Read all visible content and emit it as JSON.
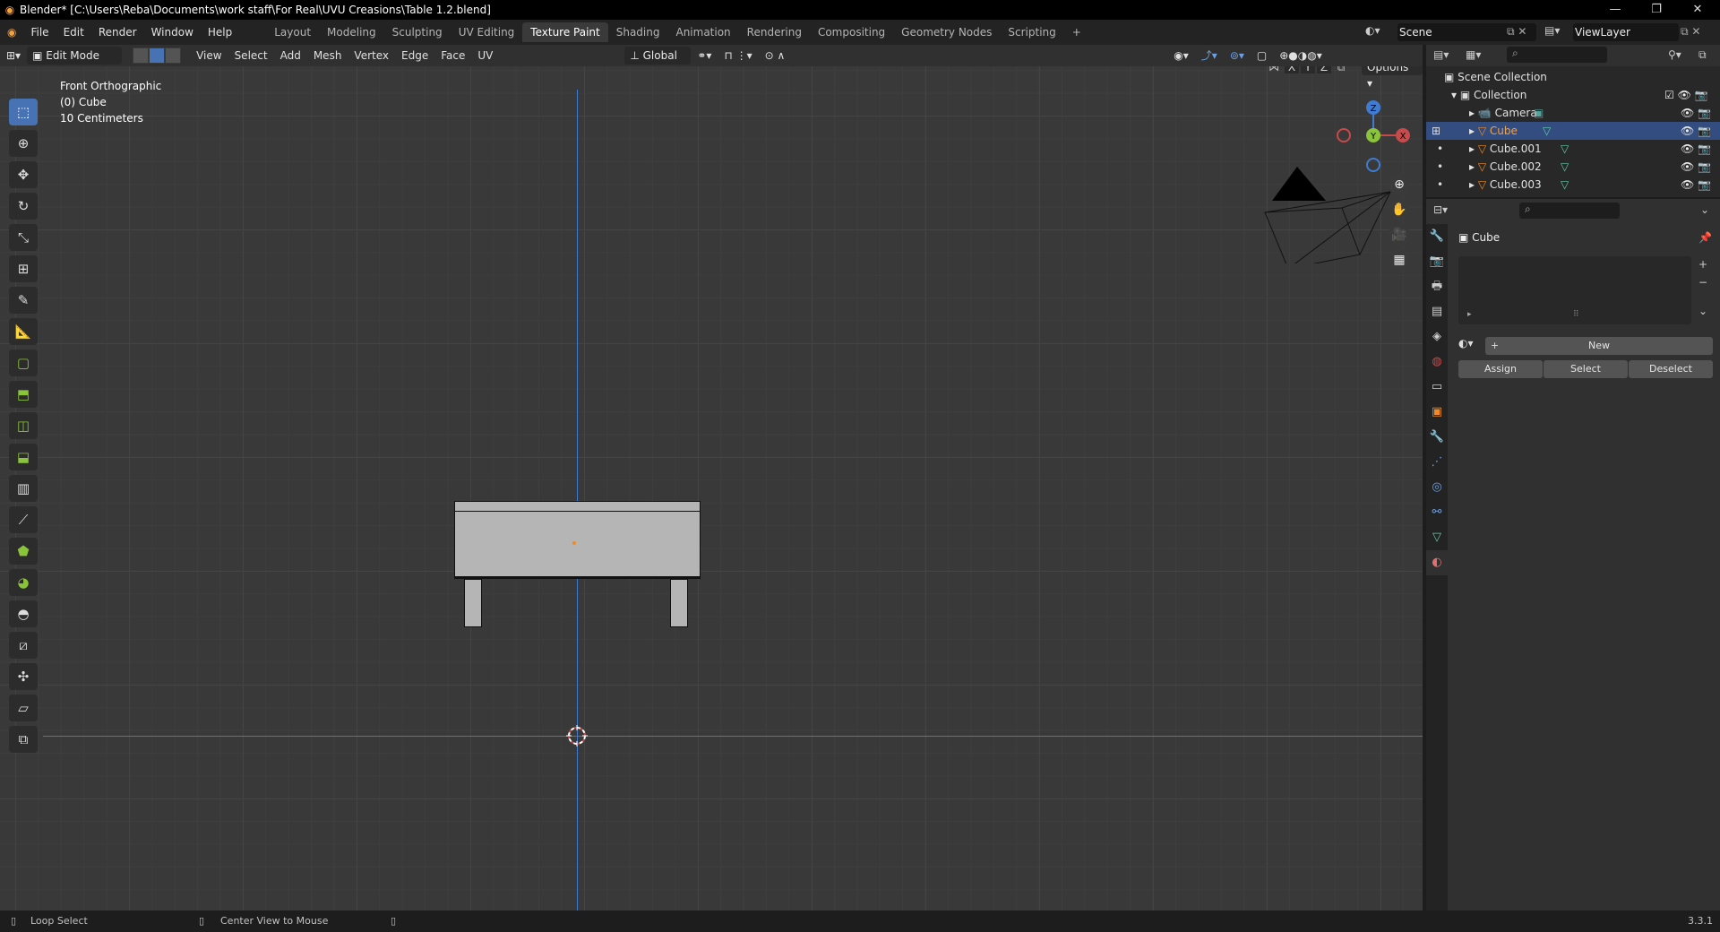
{
  "app": {
    "title": "Blender* [C:\\Users\\Reba\\Documents\\work staff\\For Real\\UVU Creasions\\Table 1.2.blend]"
  },
  "menu": [
    "File",
    "Edit",
    "Render",
    "Window",
    "Help"
  ],
  "workspaces": {
    "tabs": [
      "Layout",
      "Modeling",
      "Sculpting",
      "UV Editing",
      "Texture Paint",
      "Shading",
      "Animation",
      "Rendering",
      "Compositing",
      "Geometry Nodes",
      "Scripting"
    ],
    "active": "Texture Paint",
    "add": "+"
  },
  "scene": {
    "name": "Scene",
    "view_layer": "ViewLayer"
  },
  "header": {
    "mode": "Edit Mode",
    "menus": [
      "View",
      "Select",
      "Add",
      "Mesh",
      "Vertex",
      "Edge",
      "Face",
      "UV"
    ],
    "orientation": "Global",
    "options": "Options",
    "axes": [
      "X",
      "Y",
      "Z"
    ]
  },
  "viewport": {
    "view_name": "Front Orthographic",
    "object_name": "(0) Cube",
    "scale": "10 Centimeters",
    "gizmo": {
      "x": "X",
      "y": "Y",
      "z": "Z"
    }
  },
  "outliner": {
    "root": "Scene Collection",
    "collection": "Collection",
    "items": [
      {
        "label": "Camera",
        "selected": false
      },
      {
        "label": "Cube",
        "selected": true
      },
      {
        "label": "Cube.001",
        "selected": false
      },
      {
        "label": "Cube.002",
        "selected": false
      },
      {
        "label": "Cube.003",
        "selected": false
      }
    ]
  },
  "properties": {
    "object": "Cube",
    "new_label": "New",
    "assign_label": "Assign",
    "select_label": "Select",
    "deselect_label": "Deselect"
  },
  "status": {
    "left": "Loop Select",
    "middle": "Center View to Mouse",
    "version": "3.3.1"
  },
  "colors": {
    "accent": "#4772b3",
    "selection": "#334d80",
    "x_axis": "#c94a4a",
    "y_axis": "#8ac43b",
    "z_axis": "#3f7cd1",
    "origin": "#f08a24"
  }
}
